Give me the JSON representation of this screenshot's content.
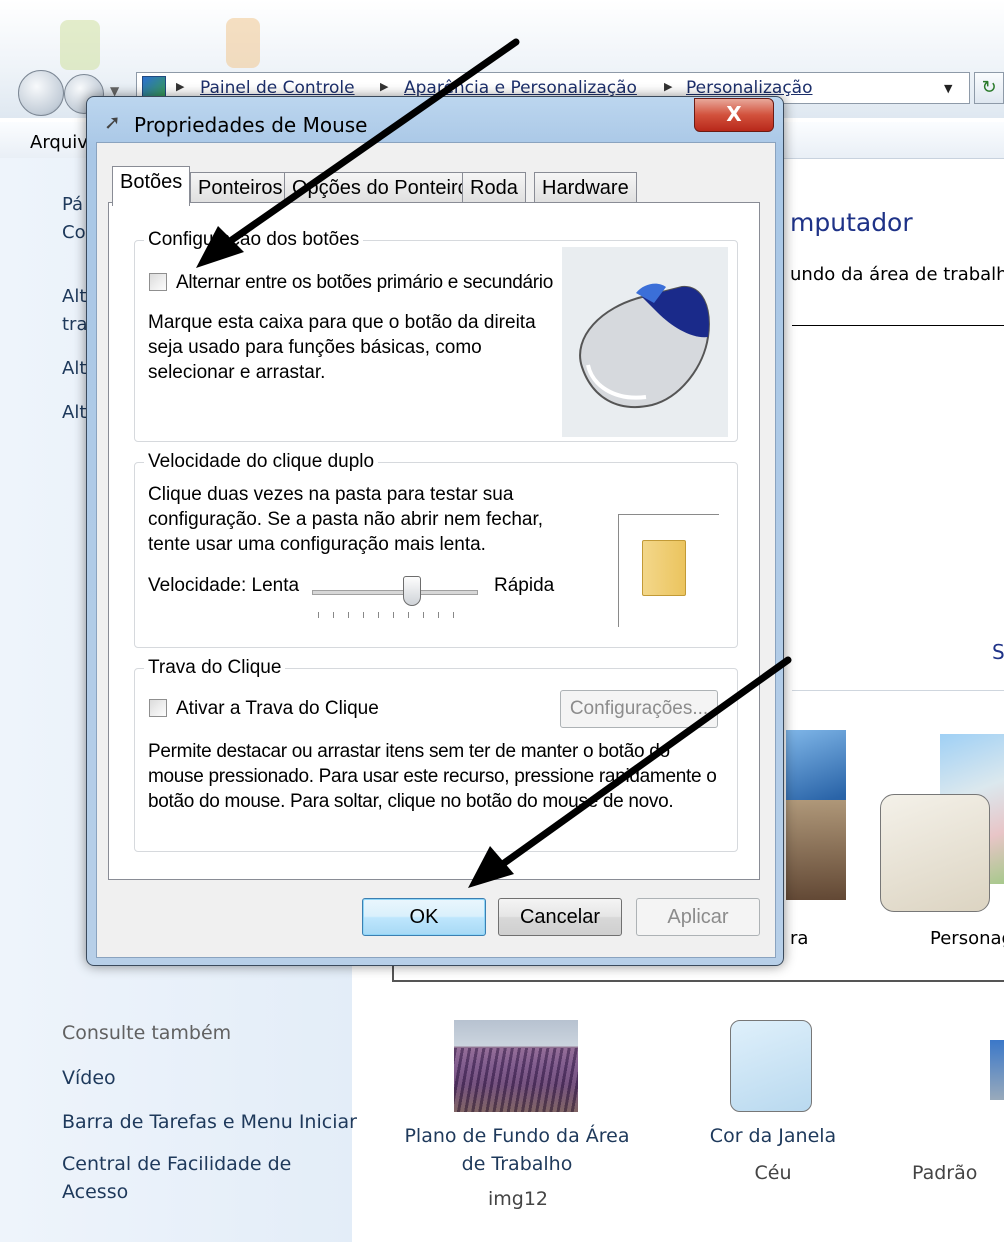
{
  "explorer": {
    "breadcrumbs": [
      "Painel de Controle",
      "Aparência e Personalização",
      "Personalização"
    ],
    "menu_first": "Arquiv",
    "sidebar_fragments": [
      "Pá",
      "Co",
      "Alt",
      "tra",
      "Alt",
      "Alt"
    ],
    "main_title_fragment": "mputador",
    "main_subtitle_fragment": "undo da área de trabalho",
    "main_link_fragment": "S",
    "theme_labels": [
      "ra",
      "Personag"
    ],
    "see_also": {
      "header": "Consulte também",
      "links": [
        "Vídeo",
        "Barra de Tarefas e Menu Iniciar",
        "Central de Facilidade de Acesso"
      ]
    },
    "bottom_items": [
      {
        "link": "Plano de Fundo da Área de Trabalho",
        "value": "img12"
      },
      {
        "link": "Cor da Janela",
        "value": "Céu"
      },
      {
        "link": "",
        "value": "Padrão"
      }
    ]
  },
  "dialog": {
    "title": "Propriedades de Mouse",
    "close_label": "X",
    "tabs": [
      "Botões",
      "Ponteiros",
      "Opções do Ponteiro",
      "Roda",
      "Hardware"
    ],
    "buttons_config": {
      "group_label": "Configuração dos botões",
      "checkbox_label": "Alternar entre os botões primário e secundário",
      "description": "Marque esta caixa para que o botão da direita seja usado para funções básicas, como selecionar e arrastar."
    },
    "double_click": {
      "group_label": "Velocidade do clique duplo",
      "description": "Clique duas vezes na pasta para testar sua configuração. Se a pasta não abrir nem fechar, tente usar uma configuração mais lenta.",
      "speed_label": "Velocidade: Lenta",
      "fast_label": "Rápida",
      "slider_value_fraction": 0.6
    },
    "click_lock": {
      "group_label": "Trava do Clique",
      "checkbox_label": "Ativar a Trava do Clique",
      "settings_button": "Configurações...",
      "description": "Permite destacar ou arrastar itens sem ter de manter o botão do mouse pressionado. Para usar este recurso, pressione rapidamente o botão do mouse. Para soltar, clique no botão do mouse de novo."
    },
    "footer_buttons": {
      "ok": "OK",
      "cancel": "Cancelar",
      "apply": "Aplicar"
    }
  },
  "colors": {
    "link": "#1e395b",
    "title_accent": "#1e3287",
    "arrow": "#000000"
  }
}
